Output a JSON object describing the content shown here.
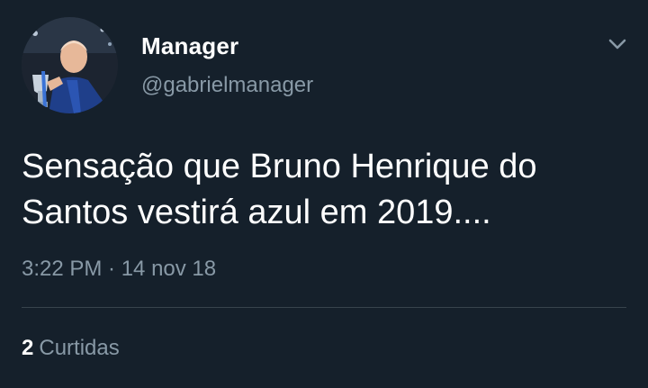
{
  "tweet": {
    "display_name": "Manager",
    "handle": "@gabrielmanager",
    "text_line1": "Sensação que Bruno Henrique do",
    "text_line2": "Santos vestirá azul em 2019....",
    "timestamp": "3:22 PM · 14 nov 18",
    "likes_count": "2",
    "likes_label": "Curtidas"
  },
  "icons": {
    "menu": "chevron-down-icon"
  },
  "colors": {
    "background": "#15202b",
    "text_primary": "#ffffff",
    "text_secondary": "#8899a6",
    "divider": "#38444d"
  }
}
